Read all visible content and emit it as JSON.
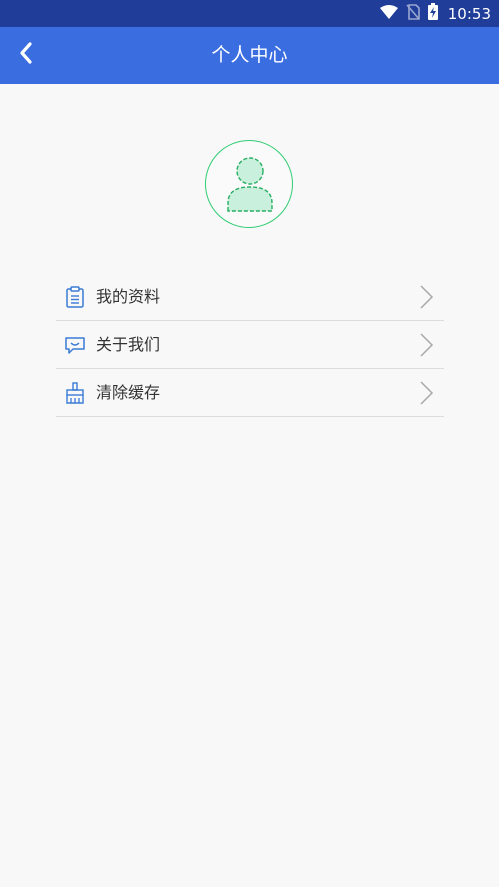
{
  "status_bar": {
    "time": "10:53",
    "icons": [
      "wifi-icon",
      "no-sim-icon",
      "battery-charging-icon"
    ]
  },
  "header": {
    "title": "个人中心",
    "back_icon": "back-arrow-icon"
  },
  "profile": {
    "avatar_icon": "default-user-avatar-icon"
  },
  "menu": {
    "items": [
      {
        "label": "我的资料",
        "icon": "clipboard-icon"
      },
      {
        "label": "关于我们",
        "icon": "chat-bubble-icon"
      },
      {
        "label": "清除缓存",
        "icon": "broom-icon"
      }
    ]
  },
  "colors": {
    "status_bar": "#1f3d99",
    "app_bar": "#3a6de0",
    "avatar_accent": "#2ecc71",
    "menu_icon": "#3a7bd5"
  }
}
